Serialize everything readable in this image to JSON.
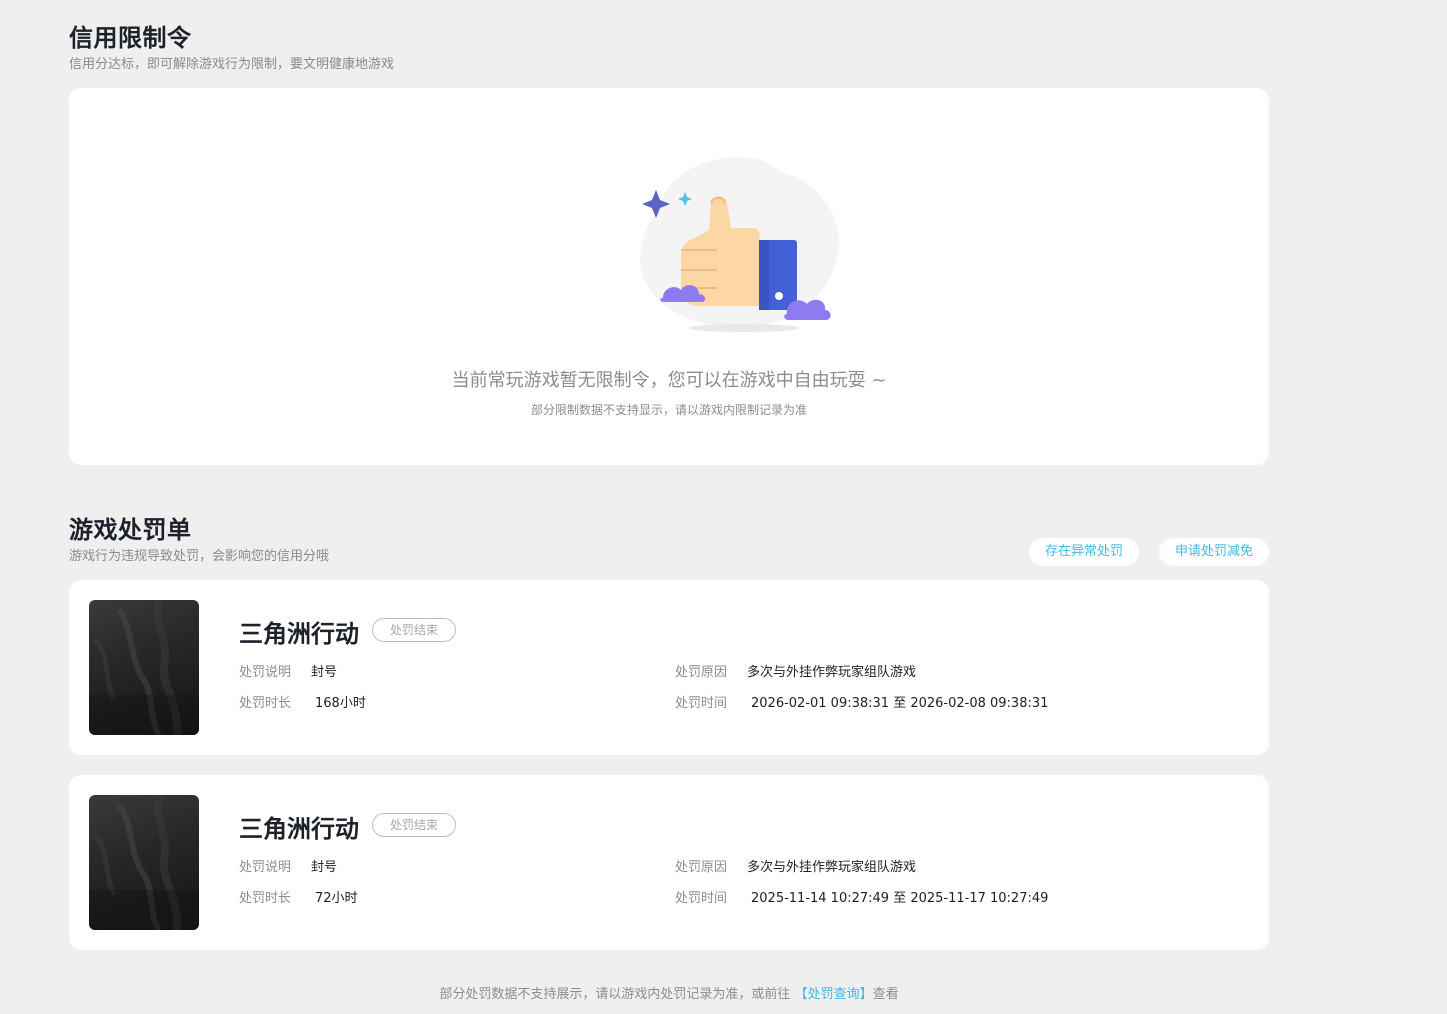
{
  "credit": {
    "title": "信用限制令",
    "subtitle": "信用分达标，即可解除游戏行为限制，要文明健康地游戏",
    "empty_main": "当前常玩游戏暂无限制令，您可以在游戏中自由玩耍 ~",
    "empty_sub": "部分限制数据不支持显示，请以游戏内限制记录为准"
  },
  "penalties": {
    "title": "游戏处罚单",
    "subtitle": "游戏行为违规导致处罚，会影响您的信用分哦",
    "btn_abnormal": "存在异常处罚",
    "btn_appeal": "申请处罚减免",
    "labels": {
      "desc": "处罚说明",
      "duration": "处罚时长",
      "reason": "处罚原因",
      "time": "处罚时间"
    },
    "items": [
      {
        "game": "三角洲行动",
        "status": "处罚结束",
        "desc": "封号",
        "duration": "168小时",
        "reason": "多次与外挂作弊玩家组队游戏",
        "time": "2026-02-01 09:38:31 至 2026-02-08 09:38:31"
      },
      {
        "game": "三角洲行动",
        "status": "处罚结束",
        "desc": "封号",
        "duration": "72小时",
        "reason": "多次与外挂作弊玩家组队游戏",
        "time": "2025-11-14 10:27:49 至 2025-11-17 10:27:49"
      }
    ],
    "footer_prefix": "部分处罚数据不支持展示，请以游戏内处罚记录为准，或前往",
    "footer_link": "【处罚查询】",
    "footer_suffix": "查看"
  },
  "colors": {
    "accent": "#3fb8e6",
    "background": "#efefef",
    "card": "#ffffff"
  },
  "icons": [
    "thumbs-up-illustration",
    "game-cover-image"
  ]
}
